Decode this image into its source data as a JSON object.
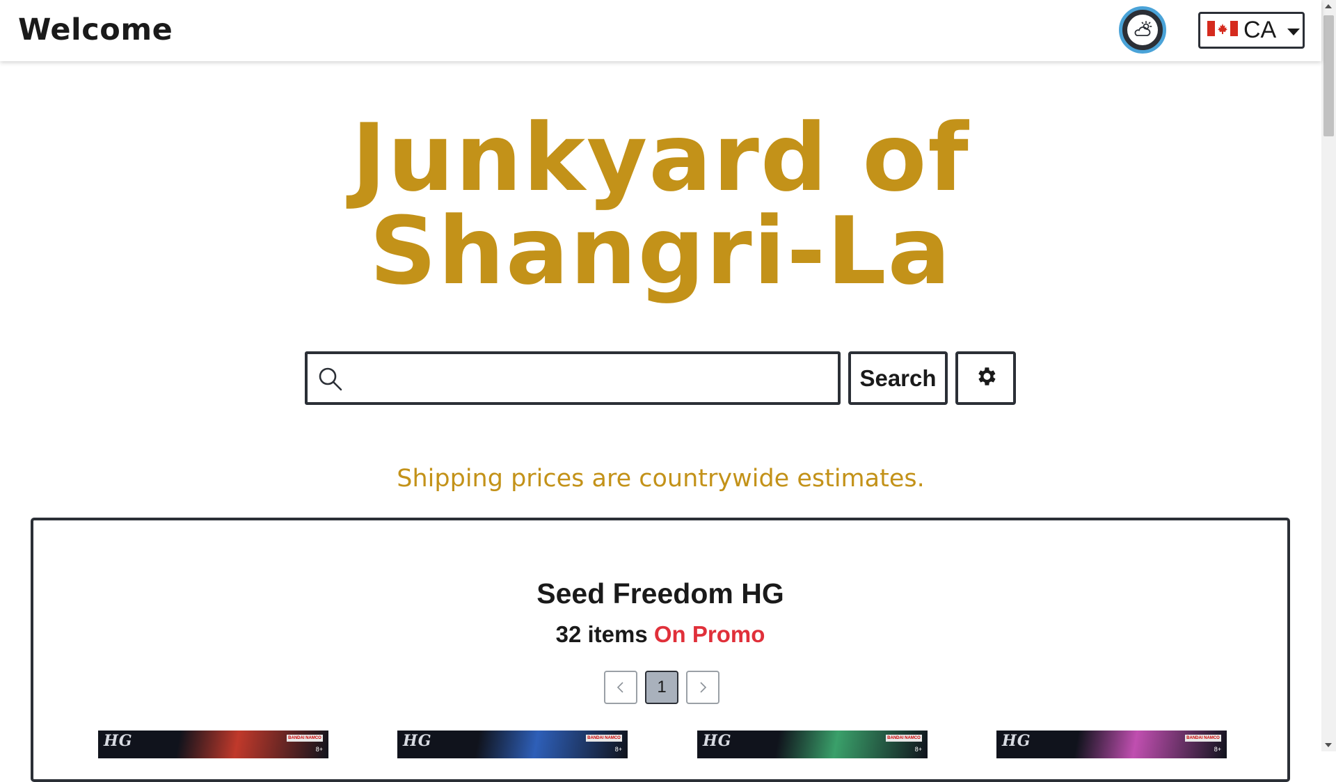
{
  "header": {
    "welcome": "Welcome",
    "theme_icon": "cloud-sun-icon",
    "country": {
      "flag_icon": "canada-flag-icon",
      "code": "CA"
    }
  },
  "hero": {
    "title_line1": "Junkyard of",
    "title_line2": "Shangri-La"
  },
  "search": {
    "value": "",
    "placeholder": "",
    "button_label": "Search",
    "settings_icon": "gear-icon"
  },
  "shipping_note": "Shipping prices are countrywide estimates.",
  "collection": {
    "title": "Seed Freedom HG",
    "count_label": "32 items",
    "promo_label": "On Promo",
    "pagination": {
      "prev_icon": "chevron-left-icon",
      "current_page": "1",
      "next_icon": "chevron-right-icon"
    },
    "products": [
      {
        "badge": "HG",
        "brand": "BANDAI NAMCO",
        "age": "8+",
        "accent": "#c0392b"
      },
      {
        "badge": "HG",
        "brand": "BANDAI NAMCO",
        "age": "8+",
        "accent": "#2e5fb8"
      },
      {
        "badge": "HG",
        "brand": "BANDAI NAMCO",
        "age": "8+",
        "accent": "#3aa06a"
      },
      {
        "badge": "HG",
        "brand": "BANDAI NAMCO",
        "age": "8+",
        "accent": "#c04fb0"
      }
    ]
  },
  "colors": {
    "accent_gold": "#c39219",
    "promo_red": "#e0303a",
    "border_dark": "#2b2f36",
    "theme_ring": "#4aa3d8"
  }
}
